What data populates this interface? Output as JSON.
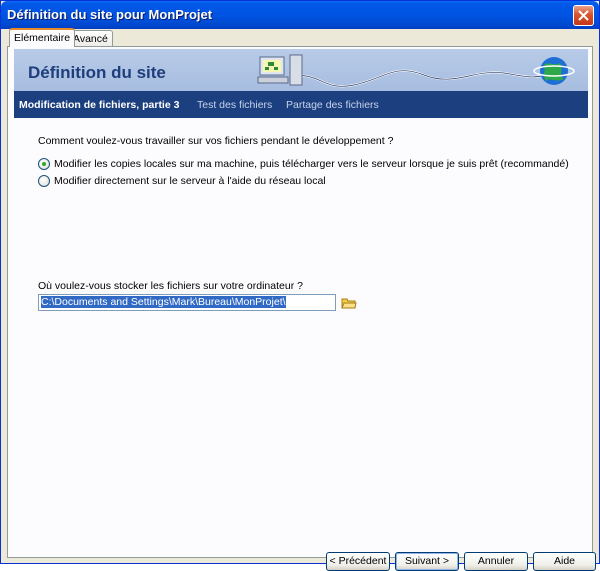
{
  "window": {
    "title": "Définition du site pour MonProjet"
  },
  "tabs": [
    {
      "label": "Elémentaire",
      "active": true
    },
    {
      "label": "Avancé",
      "active": false
    }
  ],
  "banner": {
    "title": "Définition du site"
  },
  "steps": [
    {
      "label": "Modification de fichiers, partie 3",
      "current": true
    },
    {
      "label": "Test des fichiers",
      "current": false
    },
    {
      "label": "Partage des fichiers",
      "current": false
    }
  ],
  "question1": "Comment voulez-vous travailler sur vos fichiers pendant le développement ?",
  "options": [
    {
      "label": "Modifier les copies locales sur ma machine, puis télécharger vers le serveur lorsque je suis prêt (recommandé)",
      "checked": true
    },
    {
      "label": "Modifier directement sur le serveur à l'aide du réseau local",
      "checked": false
    }
  ],
  "question2": "Où voulez-vous stocker les fichiers sur votre ordinateur ?",
  "path_value": "C:\\Documents and Settings\\Mark\\Bureau\\MonProjet\\",
  "buttons": {
    "prev": "< Précédent",
    "next": "Suivant >",
    "cancel": "Annuler",
    "help": "Aide"
  },
  "colors": {
    "title_bar": "#0054e3",
    "banner": "#a7bde0",
    "step_bar": "#1c3f7f",
    "selection": "#316ac5"
  }
}
